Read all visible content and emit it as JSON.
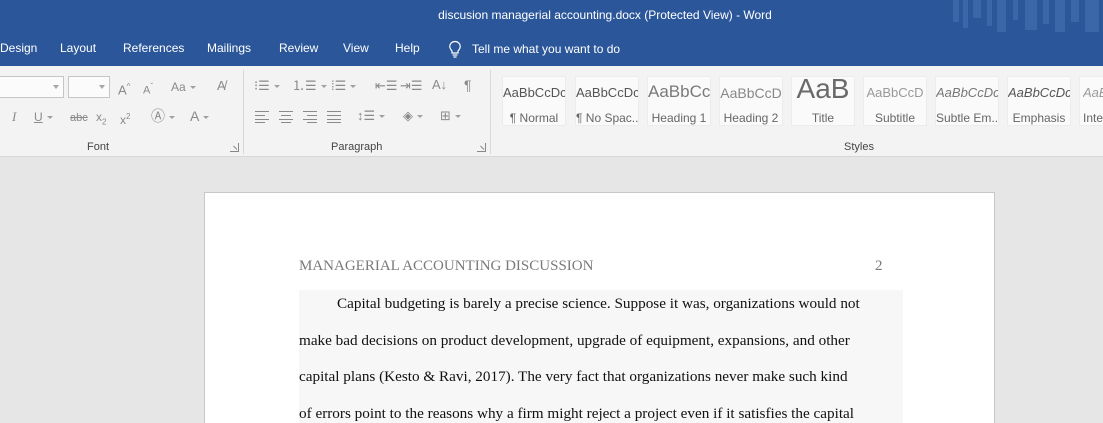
{
  "window": {
    "title": "discusion managerial accounting.docx (Protected View)  -  Word"
  },
  "menu": {
    "tabs": [
      "Design",
      "Layout",
      "References",
      "Mailings",
      "Review",
      "View",
      "Help"
    ],
    "tell_me": "Tell me what you want to do"
  },
  "ribbon": {
    "font_group": "Font",
    "paragraph_group": "Paragraph",
    "styles_group": "Styles",
    "styles": [
      {
        "sample": "AaBbCcDc",
        "name": "¶ Normal"
      },
      {
        "sample": "AaBbCcDc",
        "name": "¶ No Spac..."
      },
      {
        "sample": "AaBbCc",
        "name": "Heading 1"
      },
      {
        "sample": "AaBbCcD",
        "name": "Heading 2"
      },
      {
        "sample": "AaB",
        "name": "Title"
      },
      {
        "sample": "AaBbCcD",
        "name": "Subtitle"
      },
      {
        "sample": "AaBbCcDc",
        "name": "Subtle Em..."
      },
      {
        "sample": "AaBbCcDc",
        "name": "Emphasis"
      },
      {
        "sample": "AaBbCcDc",
        "name": "Inte..."
      }
    ]
  },
  "document": {
    "header": "MANAGERIAL ACCOUNTING DISCUSSION",
    "page_number": "2",
    "lines": [
      "Capital budgeting is barely a precise science. Suppose it was, organizations would not",
      "make bad decisions on product development, upgrade of equipment, expansions, and other",
      "capital plans (Kesto & Ravi, 2017). The very fact that organizations never make such kind",
      "of errors point to the reasons why a firm might reject a project even if it satisfies the capital"
    ]
  },
  "colors": {
    "title_bar": "#2b579a",
    "ribbon": "#f3f3f3",
    "workspace": "#e6e6e6"
  }
}
